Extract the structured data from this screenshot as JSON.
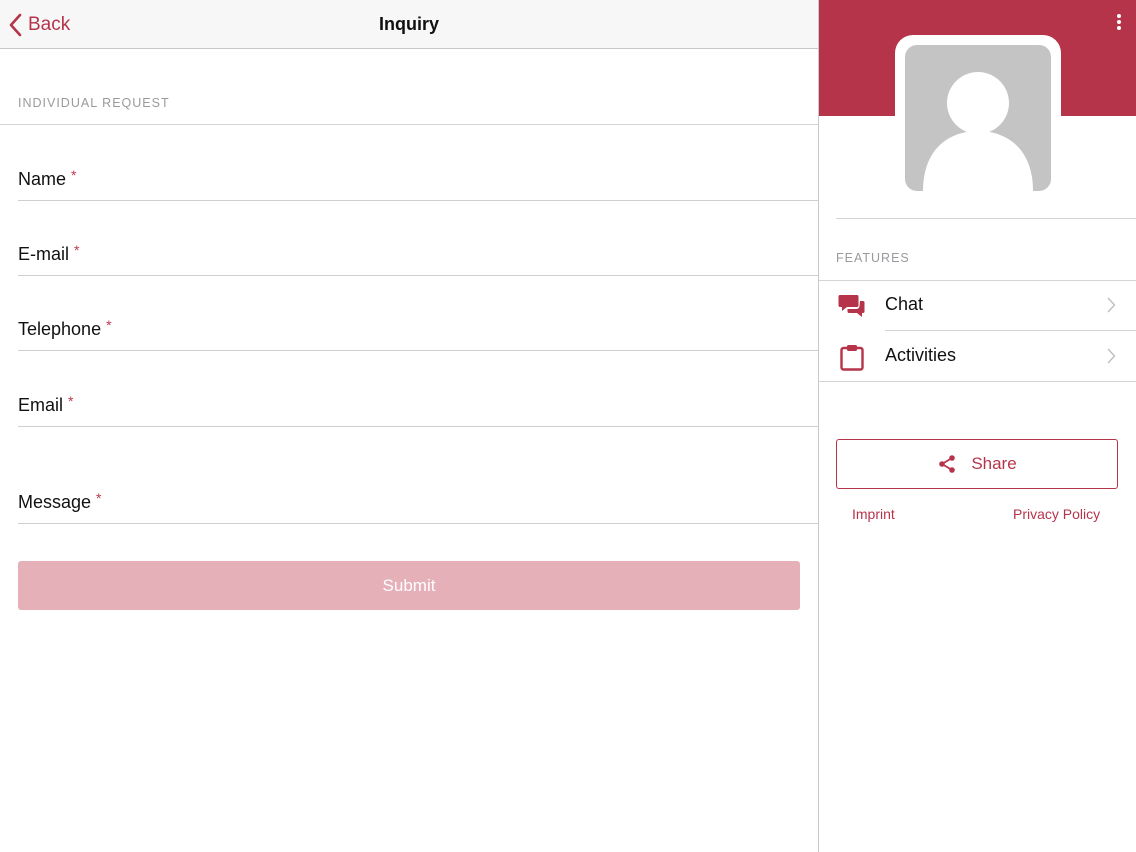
{
  "navbar": {
    "back_label": "Back",
    "title": "Inquiry"
  },
  "form": {
    "section_title": "INDIVIDUAL REQUEST",
    "required_marker": "*",
    "fields": [
      {
        "label": "Name",
        "value": ""
      },
      {
        "label": "E-mail",
        "value": ""
      },
      {
        "label": "Telephone",
        "value": ""
      },
      {
        "label": "Email",
        "value": ""
      },
      {
        "label": "Message",
        "value": ""
      }
    ],
    "submit_label": "Submit"
  },
  "sidebar": {
    "features_title": "FEATURES",
    "items": [
      {
        "label": "Chat",
        "icon": "chat-icon"
      },
      {
        "label": "Activities",
        "icon": "clipboard-icon"
      }
    ],
    "share_label": "Share",
    "imprint_label": "Imprint",
    "privacy_label": "Privacy Policy"
  },
  "colors": {
    "accent": "#b6344a",
    "submit_disabled": "#e5b0b7",
    "avatar_placeholder": "#c4c4c4"
  }
}
